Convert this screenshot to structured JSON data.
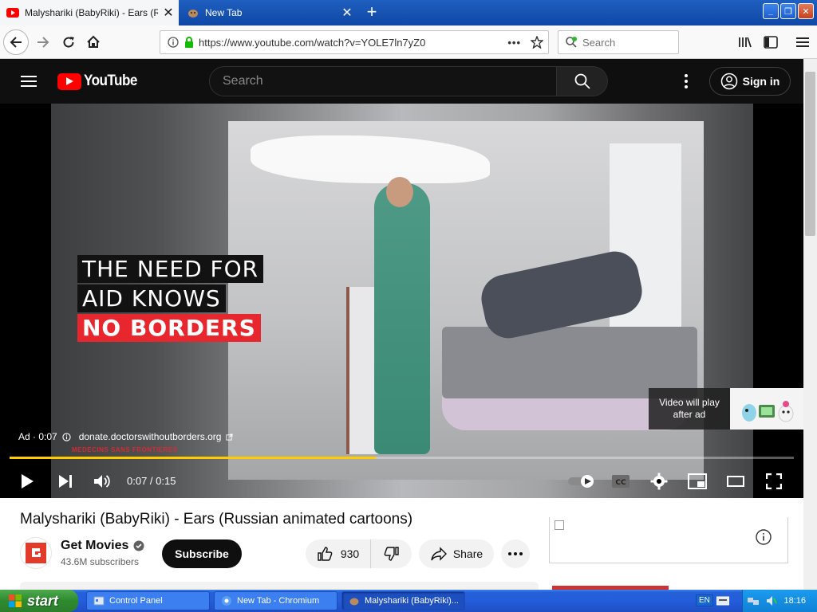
{
  "browser": {
    "tabs": [
      {
        "title": "Malyshariki (BabyRiki) - Ears (Russian animated cartoons)",
        "active": true
      },
      {
        "title": "New Tab",
        "active": false
      }
    ],
    "url": "https://www.youtube.com/watch?v=YOLE7ln7yZ0",
    "search_placeholder": "Search"
  },
  "youtube": {
    "logo_text": "YouTube",
    "search_placeholder": "Search",
    "signin_label": "Sign in",
    "player": {
      "overlay_lines": [
        "THE NEED FOR",
        "AID KNOWS",
        "NO BORDERS"
      ],
      "ad_label": "Ad · 0:07",
      "ad_domain": "donate.doctorswithoutborders.org",
      "preview_text_1": "Video will play",
      "preview_text_2": "after ad",
      "time": "0:07 / 0:15",
      "progress": 0.4667,
      "msf_text": "MEDECINS SANS FRONTIERES"
    },
    "video": {
      "title": "Malyshariki (BabyRiki) - Ears (Russian animated cartoons)",
      "channel": "Get Movies",
      "subscribers": "43.6M subscribers",
      "subscribe_label": "Subscribe",
      "likes": "930",
      "share_label": "Share"
    }
  },
  "taskbar": {
    "start_label": "start",
    "tasks": [
      "Control Panel",
      "New Tab - Chromium",
      "Malyshariki (BabyRiki)..."
    ],
    "language": "EN",
    "clock": "18:16"
  },
  "colors": {
    "progress": "#ffcc00",
    "yt_red": "#ff0000",
    "overlay_red": "#e8262d"
  }
}
